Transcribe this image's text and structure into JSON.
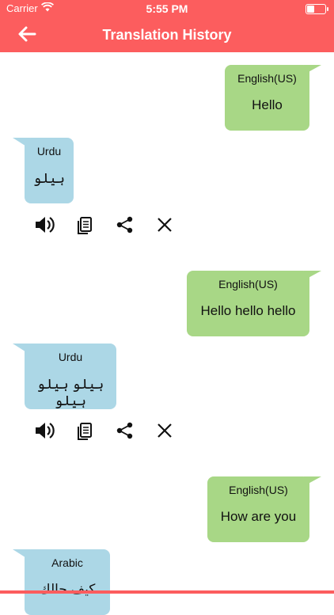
{
  "status": {
    "carrier": "Carrier",
    "time": "5:55 PM"
  },
  "header": {
    "title": "Translation History"
  },
  "history": [
    {
      "source_lang": "English(US)",
      "source_text": "Hello",
      "target_lang": "Urdu",
      "target_text": "ہیلو"
    },
    {
      "source_lang": "English(US)",
      "source_text": "Hello hello hello",
      "target_lang": "Urdu",
      "target_text": "ہیلو ہیلو ہیلو"
    },
    {
      "source_lang": "English(US)",
      "source_text": "How are you",
      "target_lang": "Arabic",
      "target_text": "كيف حالك"
    }
  ],
  "icons": {
    "back": "arrow-left-icon",
    "speaker": "speaker-icon",
    "copy": "copy-icon",
    "share": "share-icon",
    "delete": "close-icon"
  },
  "colors": {
    "header": "#fc5d5e",
    "source_bubble": "#a8d786",
    "target_bubble": "#acd7e6"
  }
}
